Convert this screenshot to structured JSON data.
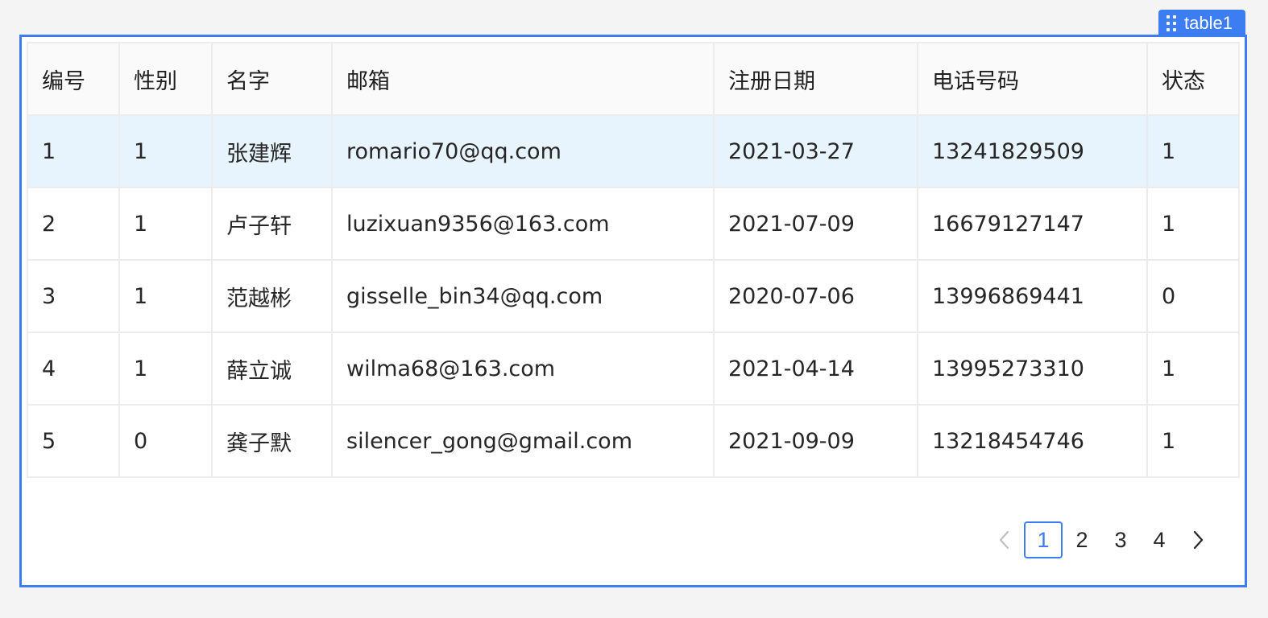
{
  "widget": {
    "name": "table1"
  },
  "table": {
    "columns": [
      "编号",
      "性别",
      "名字",
      "邮箱",
      "注册日期",
      "电话号码",
      "状态"
    ],
    "rows": [
      [
        "1",
        "1",
        "张建辉",
        "romario70@qq.com",
        "2021-03-27",
        "13241829509",
        "1"
      ],
      [
        "2",
        "1",
        "卢子轩",
        "luzixuan9356@163.com",
        "2021-07-09",
        "16679127147",
        "1"
      ],
      [
        "3",
        "1",
        "范越彬",
        "gisselle_bin34@qq.com",
        "2020-07-06",
        "13996869441",
        "0"
      ],
      [
        "4",
        "1",
        "薛立诚",
        "wilma68@163.com",
        "2021-04-14",
        "13995273310",
        "1"
      ],
      [
        "5",
        "0",
        "龚子默",
        "silencer_gong@gmail.com",
        "2021-09-09",
        "13218454746",
        "1"
      ]
    ],
    "selected_row": 1
  },
  "pagination": {
    "pages": [
      "1",
      "2",
      "3",
      "4"
    ],
    "current": "1",
    "prev_icon": "chevron-left-icon",
    "next_icon": "chevron-right-icon"
  },
  "colors": {
    "accent": "#3d7df2",
    "selected_row_bg": "#e8f4fd",
    "header_bg": "#fafafa",
    "page_bg": "#f4f4f5"
  }
}
